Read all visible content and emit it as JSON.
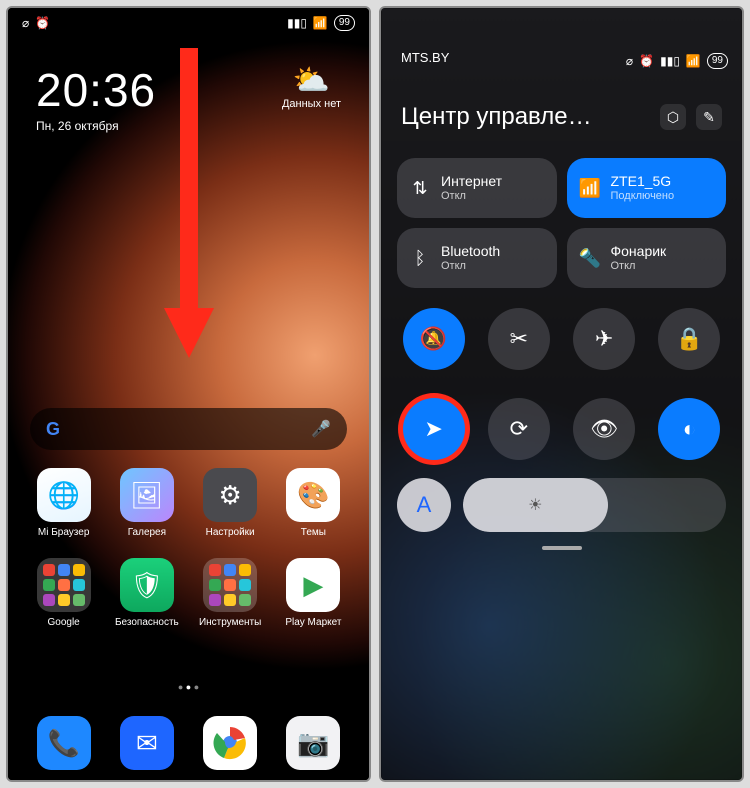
{
  "left": {
    "status": {
      "battery": "99"
    },
    "clock": {
      "time": "20:36",
      "date": "Пн, 26 октября"
    },
    "weather": {
      "label": "Данных нет"
    },
    "apps_row1": [
      {
        "id": "mi-browser",
        "label": "Mi Браузер",
        "bg": "linear-gradient(160deg,#ffffff,#e6f5ff)",
        "glyph": "🌐"
      },
      {
        "id": "gallery",
        "label": "Галерея",
        "bg": "linear-gradient(135deg,#6ec6ff,#bb86fc)",
        "glyph": "🖼"
      },
      {
        "id": "settings",
        "label": "Настройки",
        "bg": "#4a4a4e",
        "glyph": "⚙"
      },
      {
        "id": "themes",
        "label": "Темы",
        "bg": "#fff",
        "glyph": "🎨"
      }
    ],
    "apps_row2": [
      {
        "id": "google-folder",
        "label": "Google",
        "type": "folder"
      },
      {
        "id": "security",
        "label": "Безопасность",
        "bg": "linear-gradient(180deg,#1bd07b,#0ea85e)",
        "glyph": "🛡"
      },
      {
        "id": "tools-folder",
        "label": "Инструменты",
        "type": "folder"
      },
      {
        "id": "play-market",
        "label": "Play Маркет",
        "bg": "#fff",
        "glyph": "▶"
      }
    ],
    "dock": [
      {
        "id": "phone",
        "bg": "#1e88ff",
        "glyph": "📞"
      },
      {
        "id": "messages",
        "bg": "#1e66ff",
        "glyph": "✉"
      },
      {
        "id": "chrome",
        "bg": "#fff",
        "glyph": "◎"
      },
      {
        "id": "camera",
        "bg": "#f2f2f4",
        "glyph": "📷"
      }
    ]
  },
  "right": {
    "carrier": "MTS.BY",
    "battery": "99",
    "title": "Центр управле…",
    "tiles": [
      {
        "id": "internet",
        "icon": "⇅",
        "name": "Интернет",
        "sub": "Откл",
        "on": false
      },
      {
        "id": "wifi",
        "icon": "📶",
        "name": "ZTE1_5G",
        "sub": "Подключено",
        "on": true
      },
      {
        "id": "bluetooth",
        "icon": "ᛒ",
        "name": "Bluetooth",
        "sub": "Откл",
        "on": false
      },
      {
        "id": "flashlight",
        "icon": "🔦",
        "name": "Фонарик",
        "sub": "Откл",
        "on": false
      }
    ],
    "toggles1": [
      {
        "id": "mute",
        "icon": "🔕",
        "on": true
      },
      {
        "id": "screenshot",
        "icon": "✂",
        "on": false
      },
      {
        "id": "airplane",
        "icon": "✈",
        "on": false
      },
      {
        "id": "lock",
        "icon": "🔒",
        "on": false
      }
    ],
    "toggles2": [
      {
        "id": "location",
        "icon": "➤",
        "on": true,
        "highlight": true
      },
      {
        "id": "rotation-lock",
        "icon": "⟳",
        "on": false
      },
      {
        "id": "eye-comfort",
        "icon": "👁",
        "on": false
      },
      {
        "id": "dark-mode",
        "icon": "◐",
        "on": true
      }
    ],
    "autobright": {
      "label": "A"
    },
    "brightness_pct": 55
  }
}
